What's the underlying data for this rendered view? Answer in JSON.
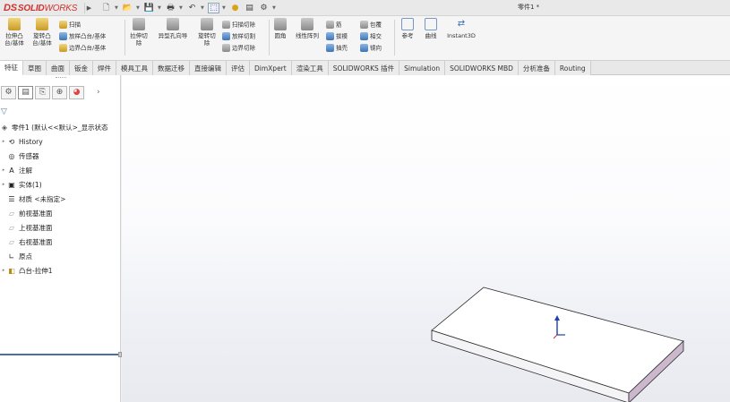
{
  "app": {
    "logo_prefix": "DS",
    "logo_brand": "SOLID",
    "logo_suffix": "WORKS",
    "document_title": "零件1 *"
  },
  "quick_access": {
    "icons": [
      "new-icon",
      "open-icon",
      "save-icon",
      "print-icon",
      "undo-icon",
      "select-icon",
      "rebuild-icon",
      "file-properties-icon",
      "options-icon"
    ]
  },
  "ribbon": {
    "extruded_boss": "拉伸凸",
    "extruded_boss_2": "台/基体",
    "revolved_boss": "旋转凸",
    "revolved_boss_2": "台/基体",
    "swept_boss": "扫描",
    "lofted_boss": "放样凸台/基体",
    "boundary_boss": "边界凸台/基体",
    "extruded_cut": "拉伸切",
    "extruded_cut_2": "除",
    "hole_wizard": "异型孔向导",
    "revolved_cut": "旋转切",
    "revolved_cut_2": "除",
    "swept_cut": "扫描切除",
    "lofted_cut": "放样切割",
    "boundary_cut": "边界切除",
    "fillet": "圆角",
    "linear_pattern": "线性阵列",
    "rib": "筋",
    "draft": "拔模",
    "shell": "抽壳",
    "wrap": "包覆",
    "intersect": "相交",
    "mirror": "镜向",
    "reference": "参考",
    "curves": "曲线",
    "instant3d": "Instant3D"
  },
  "tabs": [
    "特征",
    "草图",
    "曲面",
    "钣金",
    "焊件",
    "模具工具",
    "数据迁移",
    "直接编辑",
    "评估",
    "DimXpert",
    "渲染工具",
    "SOLIDWORKS 插件",
    "Simulation",
    "SOLIDWORKS MBD",
    "分析准备",
    "Routing"
  ],
  "active_tab": "特征",
  "feature_tree": {
    "root": "零件1 (默认<<默认>_显示状态",
    "items": [
      {
        "label": "History",
        "icon": "history-icon",
        "expandable": true
      },
      {
        "label": "传感器",
        "icon": "sensor-icon",
        "expandable": false
      },
      {
        "label": "注解",
        "icon": "annotation-icon",
        "expandable": true
      },
      {
        "label": "实体(1)",
        "icon": "solid-body-icon",
        "expandable": true
      },
      {
        "label": "材质 <未指定>",
        "icon": "material-icon",
        "expandable": false
      },
      {
        "label": "前视基准面",
        "icon": "plane-icon",
        "expandable": false
      },
      {
        "label": "上视基准面",
        "icon": "plane-icon",
        "expandable": false
      },
      {
        "label": "右视基准面",
        "icon": "plane-icon",
        "expandable": false
      },
      {
        "label": "原点",
        "icon": "origin-icon",
        "expandable": false
      },
      {
        "label": "凸台-拉伸1",
        "icon": "boss-extrude-icon",
        "expandable": true
      }
    ]
  },
  "colors": {
    "brand_red": "#d0312d",
    "part_face": "#ffffff",
    "part_side": "#cbb8cc",
    "origin_blue": "#1f3fb0",
    "rollback_bar": "#4a6fa5"
  }
}
